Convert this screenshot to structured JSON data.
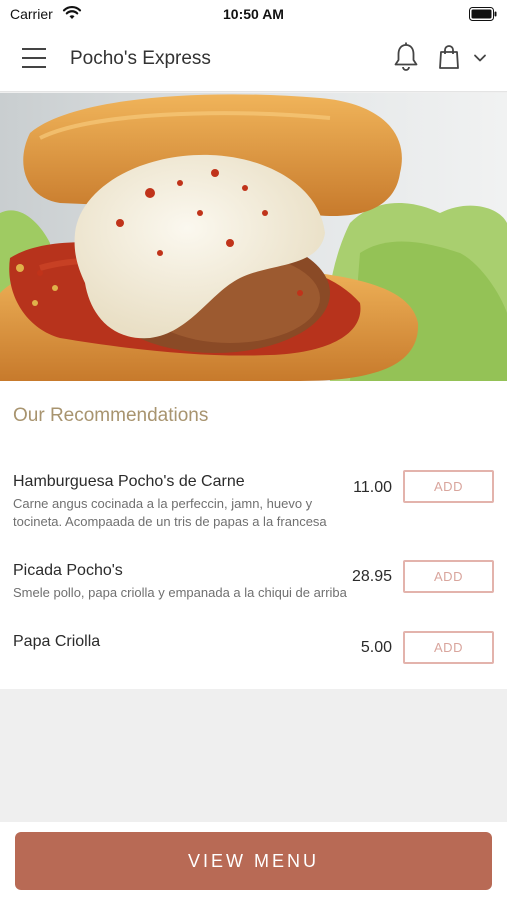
{
  "status_bar": {
    "carrier": "Carrier",
    "time": "10:50 AM"
  },
  "header": {
    "title": "Pocho's Express",
    "icons": {
      "menu": "hamburger-menu-icon",
      "notifications": "bell-icon",
      "cart": "shopping-bag-icon",
      "expand": "chevron-down-icon"
    }
  },
  "hero": {
    "image": "meatball-sandwich-photo"
  },
  "recommendations": {
    "title": "Our Recommendations",
    "items": [
      {
        "name": "Hamburguesa Pocho's de Carne",
        "description": "Carne angus cocinada a la perfeccin, jamn, huevo y tocineta. Acompaada de un tris de papas a la francesa",
        "price": "11.00",
        "add_label": "ADD"
      },
      {
        "name": "Picada Pocho's",
        "description": "Smele pollo, papa criolla y empanada a la chiqui de arriba",
        "price": "28.95",
        "add_label": "ADD"
      },
      {
        "name": "Papa Criolla",
        "description": "",
        "price": "5.00",
        "add_label": "ADD"
      }
    ]
  },
  "footer": {
    "view_menu_label": "VIEW MENU"
  },
  "colors": {
    "accent": "#b86a55",
    "section_title": "#a8946f",
    "add_border": "#e3b3ac"
  }
}
